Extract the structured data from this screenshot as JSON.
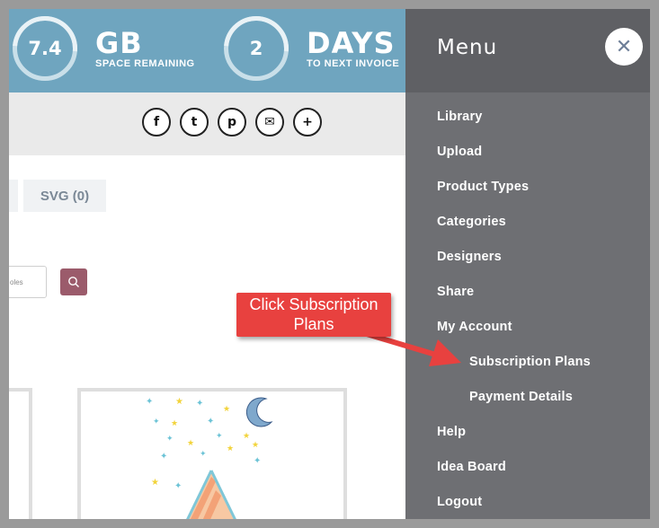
{
  "stats": {
    "space": {
      "value": "7.4",
      "unit": "GB",
      "caption": "SPACE REMAINING"
    },
    "days": {
      "value": "2",
      "unit": "DAYS",
      "caption": "TO NEXT INVOICE"
    }
  },
  "share": {
    "icons": [
      "facebook-icon",
      "twitter-icon",
      "pinterest-icon",
      "email-icon",
      "add-icon"
    ],
    "glyphs": {
      "facebook": "f",
      "twitter": "t",
      "pinterest": "p",
      "email": "✉",
      "add": "+"
    }
  },
  "filters": {
    "prev_tab": "",
    "svg_tab": "SVG (0)"
  },
  "search": {
    "placeholder_fragment": "oles"
  },
  "menu": {
    "title": "Menu",
    "close_glyph": "✕",
    "items": {
      "library": "Library",
      "upload": "Upload",
      "product_types": "Product Types",
      "categories": "Categories",
      "designers": "Designers",
      "share": "Share",
      "my_account": "My Account",
      "subscription_plans": "Subscription Plans",
      "payment_details": "Payment Details",
      "help": "Help",
      "idea_board": "Idea Board",
      "logout": "Logout"
    }
  },
  "annotation": {
    "text": "Click Subscription Plans"
  },
  "colors": {
    "banner": "#6fa5bf",
    "menu": "#6e6f73",
    "menu_header": "#5f6064",
    "callout": "#e8413f",
    "search_button": "#9b5b6b"
  }
}
